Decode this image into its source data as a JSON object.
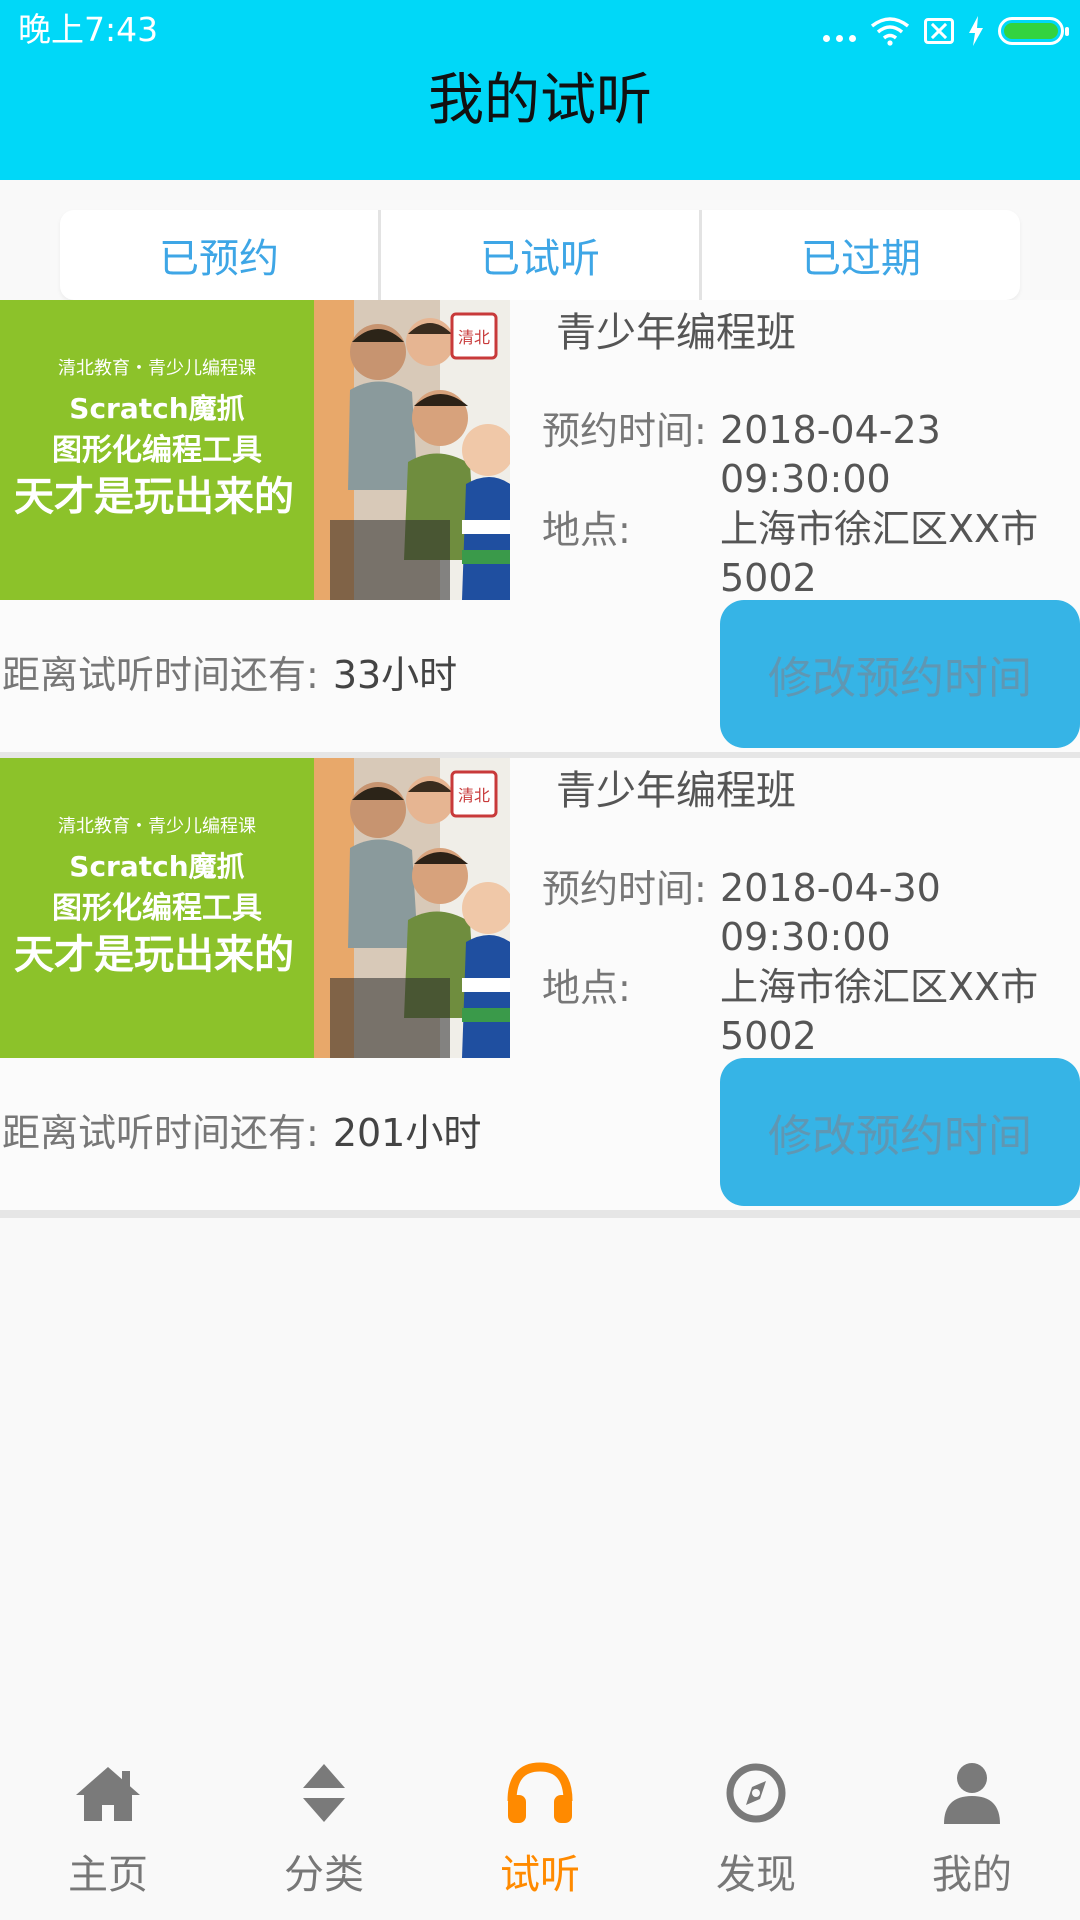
{
  "status_bar": {
    "time": "晚上7:43"
  },
  "header": {
    "title": "我的试听"
  },
  "tabs": [
    {
      "label": "已预约"
    },
    {
      "label": "已试听"
    },
    {
      "label": "已过期"
    }
  ],
  "thumbnail_text": {
    "line1": "清北教育・青少儿编程课",
    "line2": "Scratch魔抓",
    "line3": "图形化编程工具",
    "line4": "天才是玩出来的",
    "badge": "清北"
  },
  "cards": [
    {
      "course_name": "青少年编程班",
      "time_label": "预约时间:",
      "date": "2018-04-23",
      "time": "09:30:00",
      "location_label": "地点:",
      "location_line1": "上海市徐汇区XX市",
      "location_line2": "5002",
      "countdown_label": "距离试听时间还有:",
      "countdown_value": "33小时",
      "button_label": "修改预约时间"
    },
    {
      "course_name": "青少年编程班",
      "time_label": "预约时间:",
      "date": "2018-04-30",
      "time": "09:30:00",
      "location_label": "地点:",
      "location_line1": "上海市徐汇区XX市",
      "location_line2": "5002",
      "countdown_label": "距离试听时间还有:",
      "countdown_value": "201小时",
      "button_label": "修改预约时间"
    }
  ],
  "bottom_nav": [
    {
      "label": "主页",
      "icon": "home-icon"
    },
    {
      "label": "分类",
      "icon": "sort-icon"
    },
    {
      "label": "试听",
      "icon": "headphones-icon",
      "active": true
    },
    {
      "label": "发现",
      "icon": "compass-icon"
    },
    {
      "label": "我的",
      "icon": "user-icon"
    }
  ],
  "colors": {
    "header_bg": "#00d8f8",
    "tab_text": "#3ea6e6",
    "button_bg": "#36b4e6",
    "nav_active": "#ff8a00",
    "nav_inactive": "#777777"
  }
}
